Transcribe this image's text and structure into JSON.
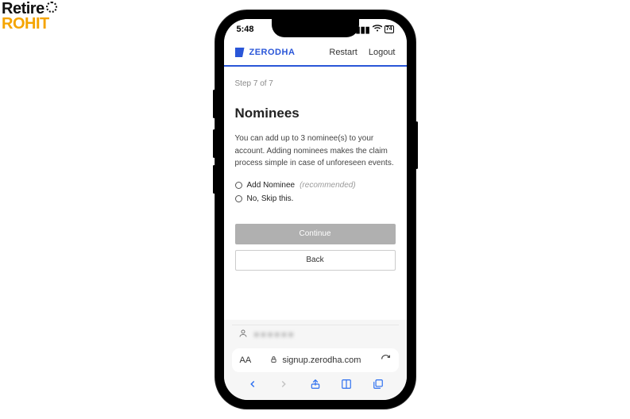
{
  "page_logo": {
    "line1": "Retire",
    "line2": "ROHIT"
  },
  "status_bar": {
    "time": "5:48",
    "battery": "74"
  },
  "header": {
    "brand": "ZERODHA",
    "restart": "Restart",
    "logout": "Logout"
  },
  "step": "Step 7 of 7",
  "title": "Nominees",
  "description": "You can add up to 3 nominee(s) to your account. Adding nominees makes the claim process simple in case of unforeseen events.",
  "options": {
    "add": "Add Nominee",
    "add_hint": "(recommended)",
    "skip": "No, Skip this."
  },
  "buttons": {
    "continue": "Continue",
    "back": "Back"
  },
  "browser": {
    "user_placeholder": "■■■■■■",
    "font_toggle": "AA",
    "url": "signup.zerodha.com"
  }
}
